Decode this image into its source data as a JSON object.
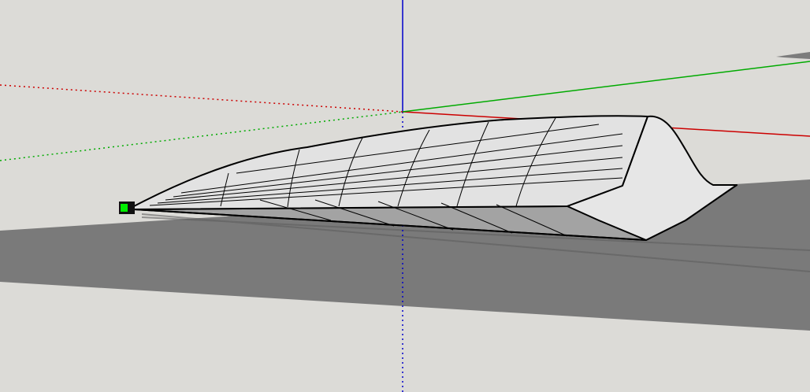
{
  "viewport": {
    "background": "#dcdbd7",
    "ground_color": "#7a7a7a",
    "axis_colors": {
      "red": "#cc0000",
      "green": "#00aa00",
      "blue": "#0000cc"
    },
    "model": {
      "surface_light": "#eaeaea",
      "surface_shade": "#9c9c9c",
      "root_face": "#e4e4e4",
      "edge": "#000000"
    },
    "endpoint_marker_color": "#00ee00"
  }
}
